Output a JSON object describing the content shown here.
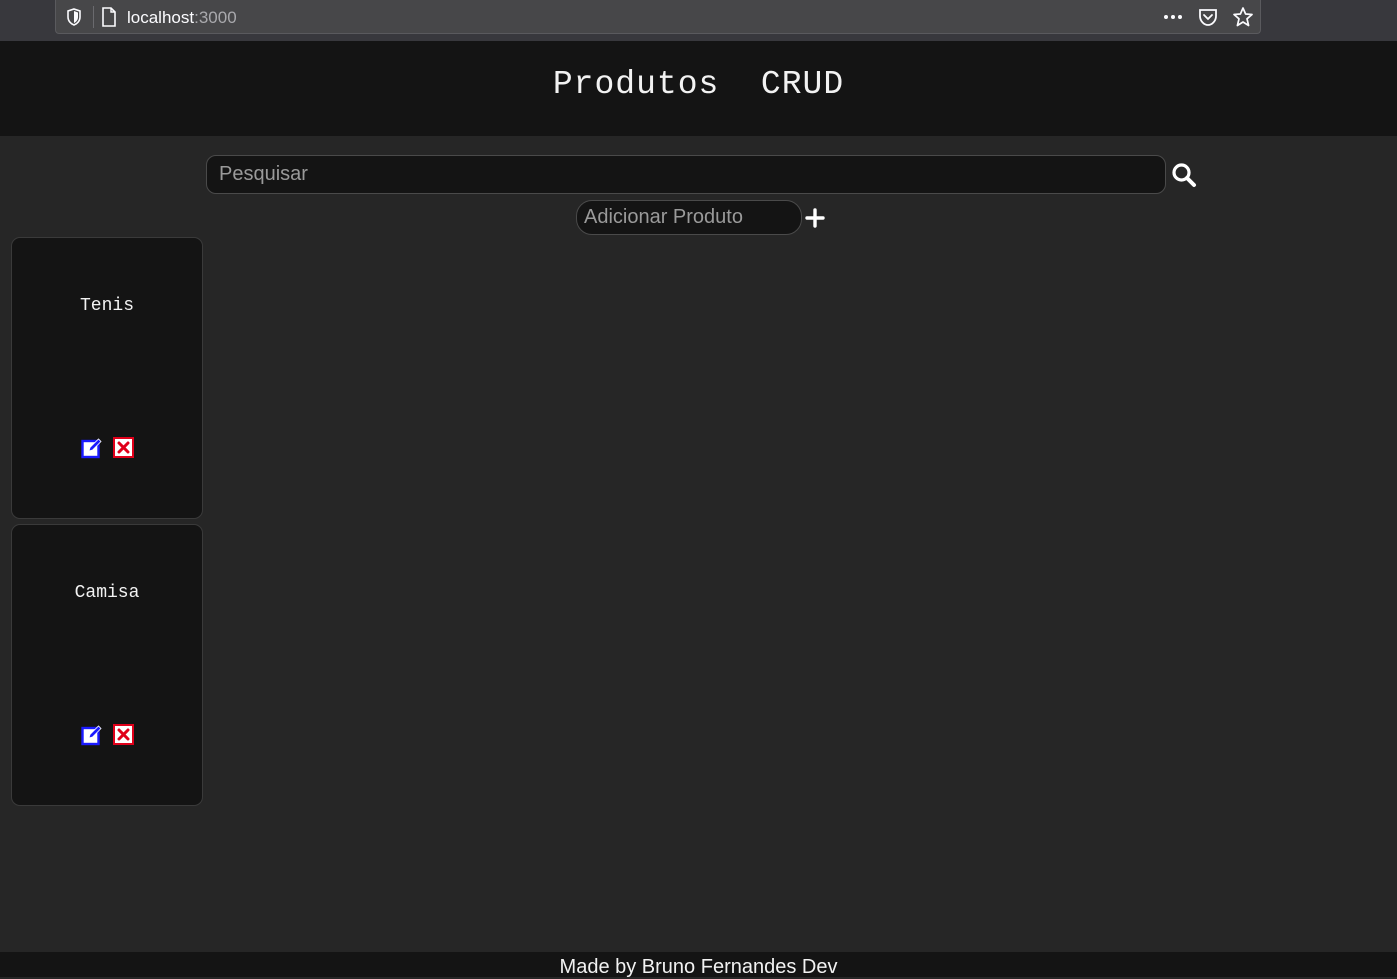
{
  "browser": {
    "url_host": "localhost",
    "url_port": ":3000"
  },
  "header": {
    "title": "Produtos  CRUD"
  },
  "search": {
    "placeholder": "Pesquisar",
    "icon": "search-icon"
  },
  "add_product": {
    "placeholder": "Adicionar Produto",
    "icon": "plus-icon"
  },
  "products": [
    {
      "name": "Tenis"
    },
    {
      "name": "Camisa"
    }
  ],
  "footer": {
    "text": "Made by Bruno Fernandes Dev"
  },
  "colors": {
    "background": "#262626",
    "panel": "#141414",
    "edit_icon": "#1a1aff",
    "delete_icon": "#e0001a"
  }
}
